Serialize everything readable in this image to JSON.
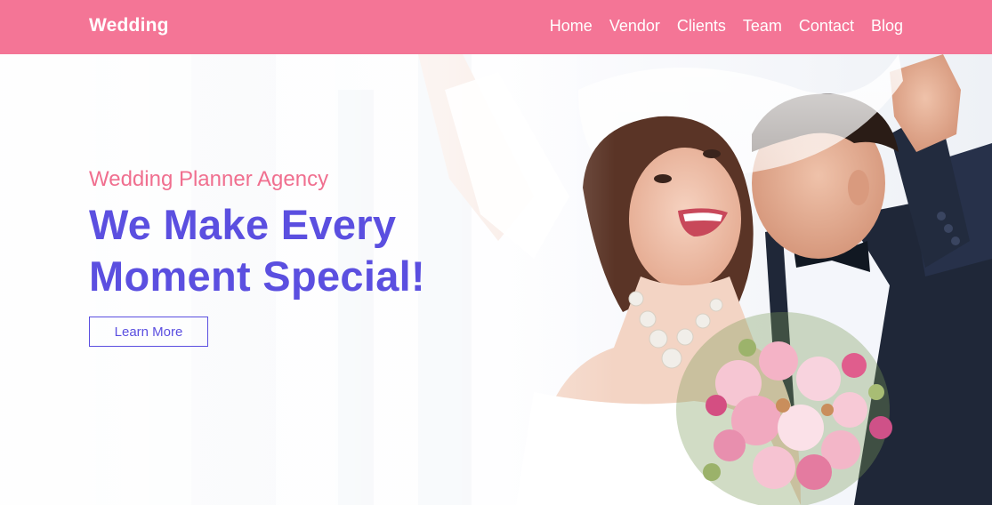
{
  "navbar": {
    "brand": "Wedding",
    "links": [
      {
        "label": "Home"
      },
      {
        "label": "Vendor"
      },
      {
        "label": "Clients"
      },
      {
        "label": "Team"
      },
      {
        "label": "Contact"
      },
      {
        "label": "Blog"
      }
    ]
  },
  "hero": {
    "subtitle": "Wedding Planner Agency",
    "title_line1": "We Make Every",
    "title_line2": "Moment Special!",
    "cta_label": "Learn More"
  },
  "colors": {
    "navbar_bg": "#f47596",
    "accent_pink": "#f06f8f",
    "accent_purple": "#5b4fe0"
  }
}
